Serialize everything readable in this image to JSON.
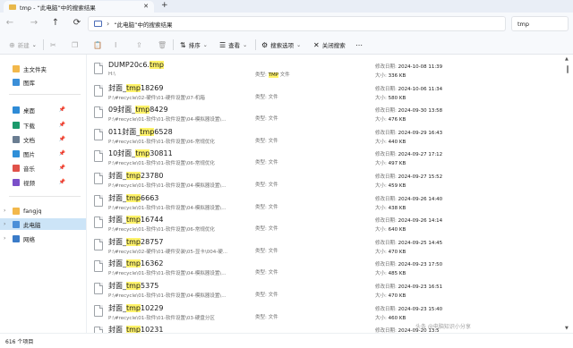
{
  "window": {
    "tab_title": "tmp - “此电脑”中的搜索结果",
    "tab_close": "✕",
    "tab_add": "+"
  },
  "address": {
    "separator": "›",
    "location": "“此电脑”中的搜索结果",
    "search_value": "tmp"
  },
  "toolbar": {
    "new_label": "新建",
    "sort_label": "排序",
    "view_label": "查看",
    "search_options_label": "搜索选项",
    "close_search_label": "关闭搜索"
  },
  "sidebar": {
    "items": [
      {
        "label": "主文件夹"
      },
      {
        "label": "图库"
      },
      {
        "label": "桌面"
      },
      {
        "label": "下载"
      },
      {
        "label": "文档"
      },
      {
        "label": "图片"
      },
      {
        "label": "音乐"
      },
      {
        "label": "视频"
      },
      {
        "label": "fangjq"
      },
      {
        "label": "此电脑"
      },
      {
        "label": "网络"
      }
    ]
  },
  "labels": {
    "type": "类型:",
    "modified": "修改日期:",
    "size": "大小:"
  },
  "files": [
    {
      "name_pre": "DUMP20c6.",
      "name_hl": "tmp",
      "name_post": "",
      "path": "H:\\",
      "type_hl": "TMP",
      "type_rest": " 文件",
      "modified": "2024-10-08 11:39",
      "size": "336 KB"
    },
    {
      "name_pre": "封面_",
      "name_hl": "tmp",
      "name_post": "18269",
      "path": "P:\\#recycle\\02-硬件\\01-硬件设置\\07-机箱",
      "type_hl": "",
      "type_rest": "文件",
      "modified": "2024-10-06 11:34",
      "size": "580 KB"
    },
    {
      "name_pre": "09封面_",
      "name_hl": "tmp",
      "name_post": "8429",
      "path": "P:\\#recycle\\01-软件\\01-软件设置\\04-模拟器设置\\...",
      "type_hl": "",
      "type_rest": "文件",
      "modified": "2024-09-30 13:58",
      "size": "476 KB"
    },
    {
      "name_pre": "011封面_",
      "name_hl": "tmp",
      "name_post": "6528",
      "path": "P:\\#recycle\\01-软件\\01-软件设置\\06-常规优化",
      "type_hl": "",
      "type_rest": "文件",
      "modified": "2024-09-29 16:43",
      "size": "440 KB"
    },
    {
      "name_pre": "10封面_",
      "name_hl": "tmp",
      "name_post": "30811",
      "path": "P:\\#recycle\\01-软件\\01-软件设置\\06-常规优化",
      "type_hl": "",
      "type_rest": "文件",
      "modified": "2024-09-27 17:12",
      "size": "497 KB"
    },
    {
      "name_pre": "封面_",
      "name_hl": "tmp",
      "name_post": "23780",
      "path": "P:\\#recycle\\01-软件\\01-软件设置\\04-模拟器设置\\...",
      "type_hl": "",
      "type_rest": "文件",
      "modified": "2024-09-27 15:52",
      "size": "459 KB"
    },
    {
      "name_pre": "封面_",
      "name_hl": "tmp",
      "name_post": "6663",
      "path": "P:\\#recycle\\01-软件\\01-软件设置\\04-模拟器设置\\...",
      "type_hl": "",
      "type_rest": "文件",
      "modified": "2024-09-26 14:40",
      "size": "438 KB"
    },
    {
      "name_pre": "封面_",
      "name_hl": "tmp",
      "name_post": "16744",
      "path": "P:\\#recycle\\01-软件\\01-软件设置\\06-常规优化",
      "type_hl": "",
      "type_rest": "文件",
      "modified": "2024-09-26 14:14",
      "size": "640 KB"
    },
    {
      "name_pre": "封面_",
      "name_hl": "tmp",
      "name_post": "28757",
      "path": "P:\\#recycle\\02-硬件\\01-硬件安装\\05-显卡\\004-硬...",
      "type_hl": "",
      "type_rest": "文件",
      "modified": "2024-09-25 14:45",
      "size": "470 KB"
    },
    {
      "name_pre": "封面_",
      "name_hl": "tmp",
      "name_post": "16362",
      "path": "P:\\#recycle\\01-软件\\01-软件设置\\04-模拟器设置\\...",
      "type_hl": "",
      "type_rest": "文件",
      "modified": "2024-09-23 17:50",
      "size": "485 KB"
    },
    {
      "name_pre": "封面_",
      "name_hl": "tmp",
      "name_post": "5375",
      "path": "P:\\#recycle\\01-软件\\01-软件设置\\04-模拟器设置\\...",
      "type_hl": "",
      "type_rest": "文件",
      "modified": "2024-09-23 16:51",
      "size": "470 KB"
    },
    {
      "name_pre": "封面_",
      "name_hl": "tmp",
      "name_post": "10229",
      "path": "P:\\#recycle\\01-软件\\01-软件设置\\03-硬盘分区",
      "type_hl": "",
      "type_rest": "文件",
      "modified": "2024-09-23 15:40",
      "size": "460 KB"
    },
    {
      "name_pre": "封面_",
      "name_hl": "tmp",
      "name_post": "10231",
      "path": "",
      "type_hl": "",
      "type_rest": "",
      "modified": "2024-09-20 13:5",
      "size": ""
    }
  ],
  "status": {
    "count_text": "616 个项目"
  },
  "watermark": "头条 @电脑知识小分享",
  "colors": {
    "highlight": "#fff36a",
    "selected": "#cce4f7",
    "accent": "#0067c0"
  }
}
